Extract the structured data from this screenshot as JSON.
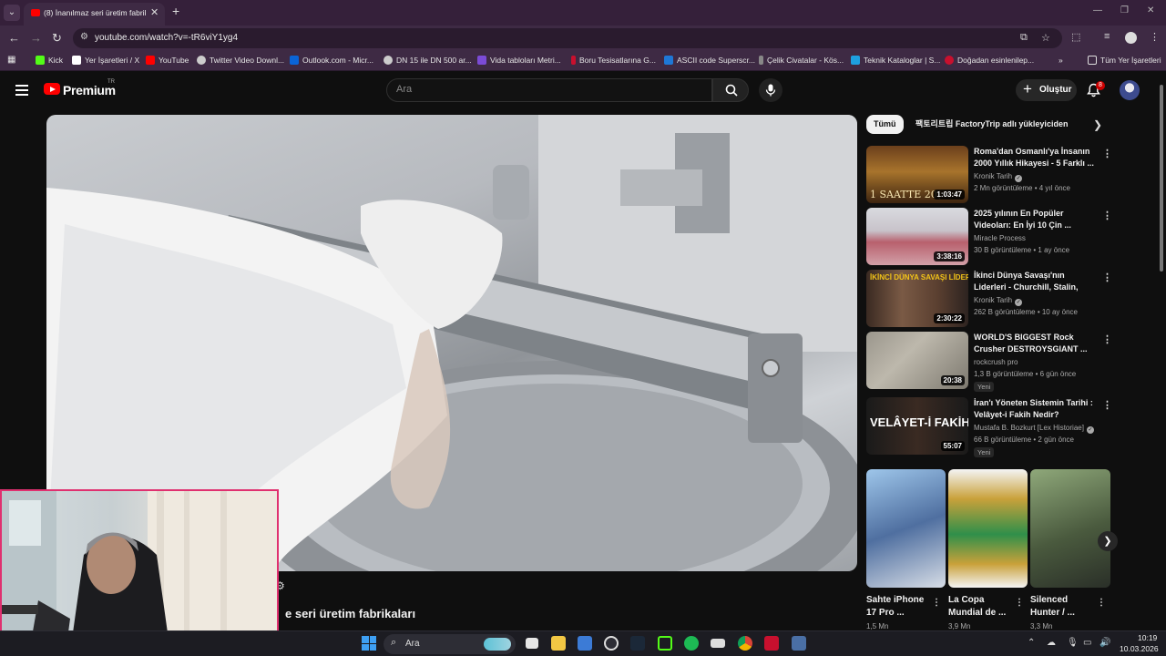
{
  "browser": {
    "tab_title": "(8) İnanılmaz seri üretim fabrikaları",
    "url": "youtube.com/watch?v=-tR6viY1yg4",
    "bookmarks": [
      {
        "label": "Kick",
        "color": "#53fc18"
      },
      {
        "label": "Yer İşaretleri / X",
        "color": "#ffffff"
      },
      {
        "label": "YouTube",
        "color": "#ff0000"
      },
      {
        "label": "Twitter Video Downl...",
        "color": "#cccccc"
      },
      {
        "label": "Outlook.com - Micr...",
        "color": "#0a64d6"
      },
      {
        "label": "DN 15 ile DN 500 ar...",
        "color": "#cccccc"
      },
      {
        "label": "Vida tabloları Metri...",
        "color": "#7b4bd6"
      },
      {
        "label": "Boru Tesisatlarına G...",
        "color": "#c8102e"
      },
      {
        "label": "ASCII code Superscr...",
        "color": "#1e78d6"
      },
      {
        "label": "Çelik Civatalar - Kös...",
        "color": "#888888"
      },
      {
        "label": "Teknik Kataloglar | S...",
        "color": "#1ea0e0"
      },
      {
        "label": "Doğadan esinlenilер...",
        "color": "#c8102e"
      }
    ],
    "all_bookmarks_label": "Tüm Yer İşaretleri"
  },
  "youtube": {
    "brand": "Premium",
    "region": "TR",
    "search_placeholder": "Ara",
    "create_label": "Oluştur",
    "notification_count": "8"
  },
  "video": {
    "title_partial": "e seri üretim fabrikaları"
  },
  "sidebar": {
    "chips": [
      "Tümü",
      "팩토리트립 FactoryTrip adlı yükleyiciden"
    ],
    "recommendations": [
      {
        "title": "Roma'dan Osmanlı'ya İnsanın 2000 Yıllık Hikayesi - 5 Farklı ...",
        "channel": "Kronik Tarih",
        "verified": true,
        "views": "2 Mn görüntüleme",
        "age": "4 yıl önce",
        "duration": "1:03:47",
        "thumb_text": "1 SAATTE 20(",
        "new": ""
      },
      {
        "title": "2025 yılının En Popüler Videoları: En İyi 10 Çin ...",
        "channel": "Miracle Process",
        "verified": false,
        "views": "30 B görüntüleme",
        "age": "1 ay önce",
        "duration": "3:38:16",
        "thumb_text": "",
        "new": ""
      },
      {
        "title": "İkinci Dünya Savaşı'nın Liderleri - Churchill, Stalin, Hitler ve ...",
        "channel": "Kronik Tarih",
        "verified": true,
        "views": "262 B görüntüleme",
        "age": "10 ay önce",
        "duration": "2:30:22",
        "thumb_text": "İKİNCİ DÜNYA SAVAŞI LİDERLERİ",
        "new": ""
      },
      {
        "title": "WORLD'S BIGGEST Rock Crusher DESTROYSGIANT ...",
        "channel": "rockcrush pro",
        "verified": false,
        "views": "1,3 B görüntüleme",
        "age": "6 gün önce",
        "duration": "20:38",
        "thumb_text": "",
        "new": "Yeni"
      },
      {
        "title": "İran'ı Yöneten Sistemin Tarihi : Velâyet-i Fakih Nedir?",
        "channel": "Mustafa B. Bozkurt [Lex Historiae]",
        "verified": true,
        "views": "66 B görüntüleme",
        "age": "2 gün önce",
        "duration": "55:07",
        "thumb_text": "VELÂYET-İ FAKİH",
        "new": "Yeni"
      }
    ],
    "shorts": [
      {
        "title": "Sahte iPhone 17 Pro ...",
        "views": "1,5 Mn"
      },
      {
        "title": "La Copa Mundial de ...",
        "views": "3,9 Mn"
      },
      {
        "title": "Silenced Hunter / ...",
        "views": "3,3 Mn"
      }
    ]
  },
  "taskbar": {
    "search_label": "Ara",
    "time": "10:19",
    "date": "10.03.2026"
  },
  "colors": {
    "accent_red": "#ff0000",
    "webcam_border": "#e0306f",
    "browser_frame": "#3e2a44"
  }
}
